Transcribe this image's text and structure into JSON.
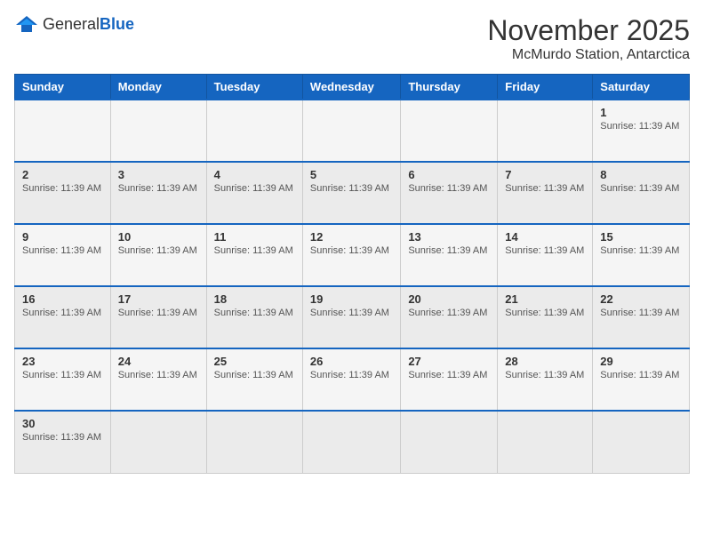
{
  "logo": {
    "text_general": "General",
    "text_blue": "Blue"
  },
  "header": {
    "month_year": "November 2025",
    "location": "McMurdo Station, Antarctica"
  },
  "days_of_week": [
    "Sunday",
    "Monday",
    "Tuesday",
    "Wednesday",
    "Thursday",
    "Friday",
    "Saturday"
  ],
  "sunrise_text": "Sunrise: 11:39 AM",
  "weeks": [
    {
      "days": [
        {
          "number": "",
          "info": ""
        },
        {
          "number": "",
          "info": ""
        },
        {
          "number": "",
          "info": ""
        },
        {
          "number": "",
          "info": ""
        },
        {
          "number": "",
          "info": ""
        },
        {
          "number": "",
          "info": ""
        },
        {
          "number": "1",
          "info": "Sunrise: 11:39 AM"
        }
      ]
    },
    {
      "days": [
        {
          "number": "2",
          "info": "Sunrise: 11:39 AM"
        },
        {
          "number": "3",
          "info": "Sunrise: 11:39 AM"
        },
        {
          "number": "4",
          "info": "Sunrise: 11:39 AM"
        },
        {
          "number": "5",
          "info": "Sunrise: 11:39 AM"
        },
        {
          "number": "6",
          "info": "Sunrise: 11:39 AM"
        },
        {
          "number": "7",
          "info": "Sunrise: 11:39 AM"
        },
        {
          "number": "8",
          "info": "Sunrise: 11:39 AM"
        }
      ]
    },
    {
      "days": [
        {
          "number": "9",
          "info": "Sunrise: 11:39 AM"
        },
        {
          "number": "10",
          "info": "Sunrise: 11:39 AM"
        },
        {
          "number": "11",
          "info": "Sunrise: 11:39 AM"
        },
        {
          "number": "12",
          "info": "Sunrise: 11:39 AM"
        },
        {
          "number": "13",
          "info": "Sunrise: 11:39 AM"
        },
        {
          "number": "14",
          "info": "Sunrise: 11:39 AM"
        },
        {
          "number": "15",
          "info": "Sunrise: 11:39 AM"
        }
      ]
    },
    {
      "days": [
        {
          "number": "16",
          "info": "Sunrise: 11:39 AM"
        },
        {
          "number": "17",
          "info": "Sunrise: 11:39 AM"
        },
        {
          "number": "18",
          "info": "Sunrise: 11:39 AM"
        },
        {
          "number": "19",
          "info": "Sunrise: 11:39 AM"
        },
        {
          "number": "20",
          "info": "Sunrise: 11:39 AM"
        },
        {
          "number": "21",
          "info": "Sunrise: 11:39 AM"
        },
        {
          "number": "22",
          "info": "Sunrise: 11:39 AM"
        }
      ]
    },
    {
      "days": [
        {
          "number": "23",
          "info": "Sunrise: 11:39 AM"
        },
        {
          "number": "24",
          "info": "Sunrise: 11:39 AM"
        },
        {
          "number": "25",
          "info": "Sunrise: 11:39 AM"
        },
        {
          "number": "26",
          "info": "Sunrise: 11:39 AM"
        },
        {
          "number": "27",
          "info": "Sunrise: 11:39 AM"
        },
        {
          "number": "28",
          "info": "Sunrise: 11:39 AM"
        },
        {
          "number": "29",
          "info": "Sunrise: 11:39 AM"
        }
      ]
    },
    {
      "days": [
        {
          "number": "30",
          "info": "Sunrise: 11:39 AM"
        },
        {
          "number": "",
          "info": ""
        },
        {
          "number": "",
          "info": ""
        },
        {
          "number": "",
          "info": ""
        },
        {
          "number": "",
          "info": ""
        },
        {
          "number": "",
          "info": ""
        },
        {
          "number": "",
          "info": ""
        }
      ]
    }
  ]
}
